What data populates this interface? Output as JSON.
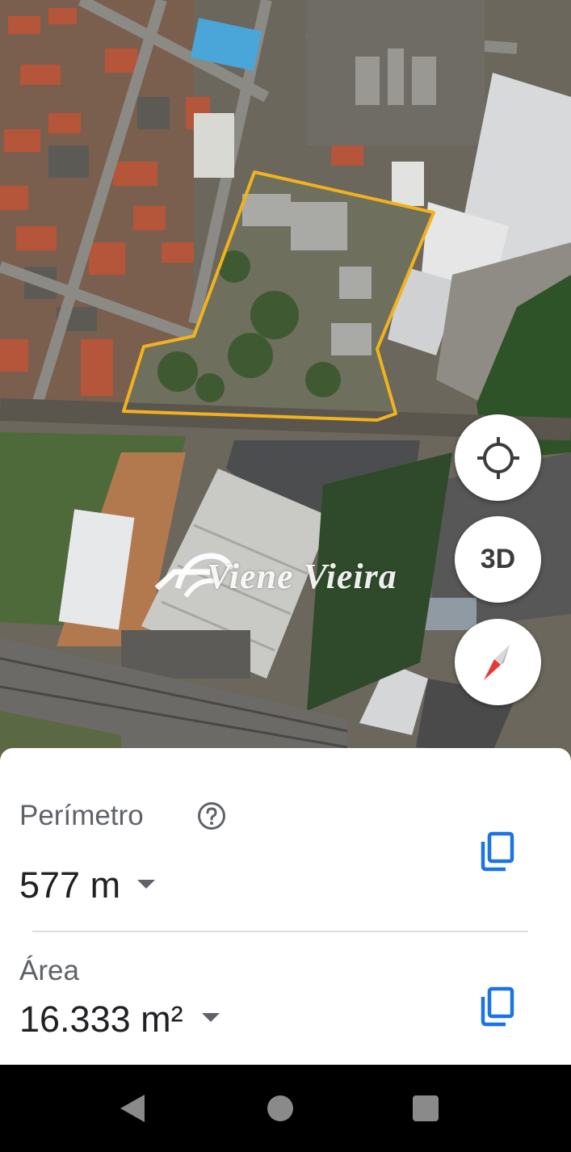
{
  "map": {
    "controls": {
      "locate_icon": "crosshair-icon",
      "three_d_label": "3D",
      "compass_icon": "compass-icon"
    },
    "watermark": "Viene Vieira",
    "boundary_color": "#f2b21e"
  },
  "measurements": {
    "perimeter": {
      "label": "Perímetro",
      "value": "577 m",
      "help_icon": "help-circle-icon",
      "copy_icon": "copy-icon"
    },
    "area": {
      "label": "Área",
      "value": "16.333 m²",
      "copy_icon": "copy-icon"
    },
    "accent_color": "#1a73e8"
  },
  "navigation_bar": {
    "buttons": [
      "back-icon",
      "home-icon",
      "recents-icon"
    ]
  }
}
